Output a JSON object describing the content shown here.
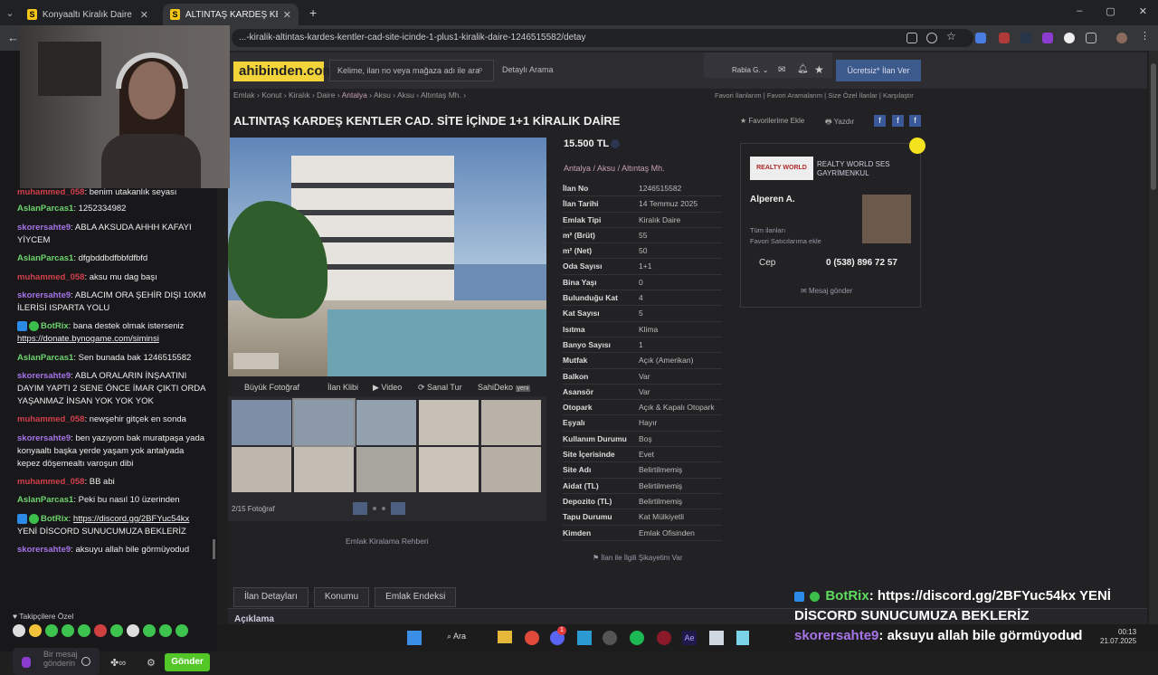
{
  "browser": {
    "tabs": [
      {
        "label": "Konyaaltı Kiralık Daire Fiyatları"
      },
      {
        "label": "ALTINTAŞ KARDEŞ KENTLER CAD"
      }
    ],
    "url": "...-kiralik-altintas-kardes-kentler-cad-site-icinde-1-plus1-kiralik-daire-1246515582/detay",
    "new_tab": "+"
  },
  "chat": {
    "messages": [
      {
        "user": "muhammed_058",
        "sep": ": ",
        "text": "benim utakanlık seyası",
        "color": "red"
      },
      {
        "user": "AslanParcas1",
        "sep": ": ",
        "text": "1252334982",
        "color": "green"
      },
      {
        "user": "skorersahte9",
        "sep": ": ",
        "text": "ABLA AKSUDA AHHH KAFAYI YİYCEM",
        "color": "purple"
      },
      {
        "user": "AslanParcas1",
        "sep": ": ",
        "text": "dfgbddbdfbbfdfbfd",
        "color": "green"
      },
      {
        "user": "muhammed_058",
        "sep": ": ",
        "text": "aksu mu dag başı",
        "color": "red"
      },
      {
        "user": "skorersahte9",
        "sep": ": ",
        "text": "ABLACIM ORA ŞEHİR DIŞI 10KM İLERİSİ ISPARTA YOLU",
        "color": "purple"
      },
      {
        "user": "BotRix",
        "sep": ": ",
        "text": "bana destek olmak isterseniz",
        "link": "https://donate.bynogame.com/siminsi",
        "color": "green",
        "bot": true
      },
      {
        "user": "AslanParcas1",
        "sep": ": ",
        "text": "Sen bunada bak 1246515582",
        "color": "green"
      },
      {
        "user": "skorersahte9",
        "sep": ": ",
        "text": "ABLA ORALARIN İNŞAATINI DAYIM YAPTI 2 SENE ÖNCE İMAR ÇIKTI ORDA YAŞANMAZ İNSAN YOK YOK YOK",
        "color": "purple"
      },
      {
        "user": "muhammed_058",
        "sep": ": ",
        "text": "newşehir gitçek en sonda",
        "color": "red"
      },
      {
        "user": "skorersahte9",
        "sep": ": ",
        "text": "ben yazıyom bak muratpaşa yada konyaaltı başka yerde yaşam yok antalyada kepez döşemealtı varoşun dibi",
        "color": "purple"
      },
      {
        "user": "muhammed_058",
        "sep": ": ",
        "text": "BB abi",
        "color": "red"
      },
      {
        "user": "AslanParcas1",
        "sep": ": ",
        "text": "Peki bu nasıl 10 üzerinden",
        "color": "green"
      },
      {
        "user": "BotRix",
        "sep": ": ",
        "link": "https://discord.gg/2BFYuc54kx",
        "text": "YENİ DİSCORD SUNUCUMUZA BEKLERİZ",
        "color": "green",
        "bot": true
      },
      {
        "user": "skorersahte9",
        "sep": ": ",
        "text": "aksuyu allah bile görmüyodud",
        "color": "purple"
      }
    ],
    "followers_label": "Takipçilere Özel",
    "input_placeholder": "Bir mesaj gönderin",
    "send_label": "Gönder"
  },
  "site": {
    "logo": "ahibinden.com",
    "search_placeholder": "Kelime, ilan no veya mağaza adı ile ara",
    "detailed_search": "Detaylı Arama",
    "user": "Rabia G.",
    "free_listing": "Ücretsiz* İlan Ver",
    "breadcrumb": [
      "Emlak",
      "Konut",
      "Kiralık",
      "Daire",
      "Antalya",
      "Aksu",
      "Aksu",
      "Altıntaş Mh."
    ],
    "top_links": [
      "Favori İlanlarım",
      "Favori Aramalarım",
      "Size Özel İlanlar",
      "Karşılaştır"
    ],
    "title": "ALTINTAŞ KARDEŞ KENTLER CAD. SİTE İÇİNDE 1+1 KİRALIK DAİRE",
    "fav_add": "Favorilerime Ekle",
    "print": "Yazdır",
    "photo_tools": [
      "Büyük Fotoğraf",
      "İlan Klibi",
      "Video",
      "Sanal Tur",
      "SahiDeko"
    ],
    "new_badge": "yeni",
    "photo_count": "2/15 Fotoğraf",
    "guide": "Emlak Kiralama Rehberi",
    "price": "15.500 TL",
    "location": [
      "Antalya",
      "Aksu",
      "Altıntaş Mh."
    ],
    "details": [
      {
        "k": "İlan No",
        "v": "1246515582"
      },
      {
        "k": "İlan Tarihi",
        "v": "14 Temmuz 2025"
      },
      {
        "k": "Emlak Tipi",
        "v": "Kiralık Daire"
      },
      {
        "k": "m² (Brüt)",
        "v": "55"
      },
      {
        "k": "m² (Net)",
        "v": "50"
      },
      {
        "k": "Oda Sayısı",
        "v": "1+1"
      },
      {
        "k": "Bina Yaşı",
        "v": "0"
      },
      {
        "k": "Bulunduğu Kat",
        "v": "4"
      },
      {
        "k": "Kat Sayısı",
        "v": "5"
      },
      {
        "k": "Isıtma",
        "v": "Klima"
      },
      {
        "k": "Banyo Sayısı",
        "v": "1"
      },
      {
        "k": "Mutfak",
        "v": "Açık (Amerikan)"
      },
      {
        "k": "Balkon",
        "v": "Var"
      },
      {
        "k": "Asansör",
        "v": "Var"
      },
      {
        "k": "Otopark",
        "v": "Açık & Kapalı Otopark"
      },
      {
        "k": "Eşyalı",
        "v": "Hayır"
      },
      {
        "k": "Kullanım Durumu",
        "v": "Boş"
      },
      {
        "k": "Site İçerisinde",
        "v": "Evet"
      },
      {
        "k": "Site Adı",
        "v": "Belirtilmemiş"
      },
      {
        "k": "Aidat (TL)",
        "v": "Belirtilmemiş"
      },
      {
        "k": "Depozito (TL)",
        "v": "Belirtilmemiş"
      },
      {
        "k": "Tapu Durumu",
        "v": "Kat Mülkiyetli"
      },
      {
        "k": "Kimden",
        "v": "Emlak Ofisinden"
      }
    ],
    "complaint": "İlan ile İlgili Şikayetim Var",
    "seller": {
      "agency": "REALTY WORLD SES GAYRİMENKUL",
      "agency_logo": "REALTY WORLD",
      "name": "Alperen A.",
      "links": [
        "Tüm ilanları",
        "Favori Satıcılarıma ekle"
      ],
      "phone_label": "Cep",
      "phone": "0 (538) 896 72 57",
      "message": "Mesaj gönder"
    },
    "bottom_tabs": [
      "İlan Detayları",
      "Konumu",
      "Emlak Endeksi"
    ],
    "desc_label": "Açıklama"
  },
  "overlay": {
    "user": "BotRix",
    "text": ": https://discord.gg/2BFYuc54kx YENİ DİSCORD SUNUCUMUZA BEKLERİZ",
    "user2": "skorersahte9",
    "text2": ": aksuyu allah bile görmüyodud"
  },
  "taskbar": {
    "search": "Ara",
    "time": "00:13",
    "date": "21.07.2025",
    "badge_count": "1"
  }
}
